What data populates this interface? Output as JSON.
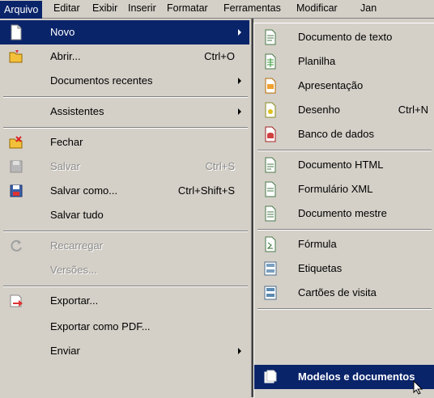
{
  "menubar": {
    "items": [
      "Arquivo",
      "Editar",
      "Exibir",
      "Inserir",
      "Formatar",
      "Ferramentas",
      "Modificar",
      "Jan"
    ]
  },
  "file_menu": {
    "items": [
      {
        "label": "Novo",
        "icon": "new-document-icon"
      },
      {
        "label": "Abrir...",
        "shortcut": "Ctrl+O",
        "icon": "open-folder-icon"
      },
      {
        "label": "Documentos recentes"
      },
      {
        "label": "Assistentes"
      },
      {
        "label": "Fechar",
        "icon": "close-document-icon"
      },
      {
        "label": "Salvar",
        "shortcut": "Ctrl+S",
        "icon": "save-icon"
      },
      {
        "label": "Salvar como...",
        "shortcut": "Ctrl+Shift+S",
        "icon": "save-as-icon"
      },
      {
        "label": "Salvar tudo"
      },
      {
        "label": "Recarregar",
        "icon": "reload-icon"
      },
      {
        "label": "Versões..."
      },
      {
        "label": "Exportar...",
        "icon": "export-icon"
      },
      {
        "label": "Exportar como PDF..."
      },
      {
        "label": "Enviar"
      }
    ]
  },
  "new_submenu": {
    "items": [
      {
        "label": "Documento de texto",
        "icon": "text-document-icon"
      },
      {
        "label": "Planilha",
        "icon": "spreadsheet-icon"
      },
      {
        "label": "Apresentação",
        "icon": "presentation-icon"
      },
      {
        "label": "Desenho",
        "shortcut": "Ctrl+N",
        "icon": "drawing-icon"
      },
      {
        "label": "Banco de dados",
        "icon": "database-icon"
      },
      {
        "label": "Documento HTML",
        "icon": "html-document-icon"
      },
      {
        "label": "Formulário XML",
        "icon": "xml-form-icon"
      },
      {
        "label": "Documento mestre",
        "icon": "master-document-icon"
      },
      {
        "label": "Fórmula",
        "icon": "formula-icon"
      },
      {
        "label": "Etiquetas",
        "icon": "labels-icon"
      },
      {
        "label": "Cartões de visita",
        "icon": "business-cards-icon"
      },
      {
        "label": "Modelos e documentos",
        "icon": "templates-icon"
      }
    ]
  },
  "colors": {
    "menu_bg": "#d4d0c8",
    "highlight": "#0a246a",
    "disabled_text": "#8c8c8c"
  }
}
